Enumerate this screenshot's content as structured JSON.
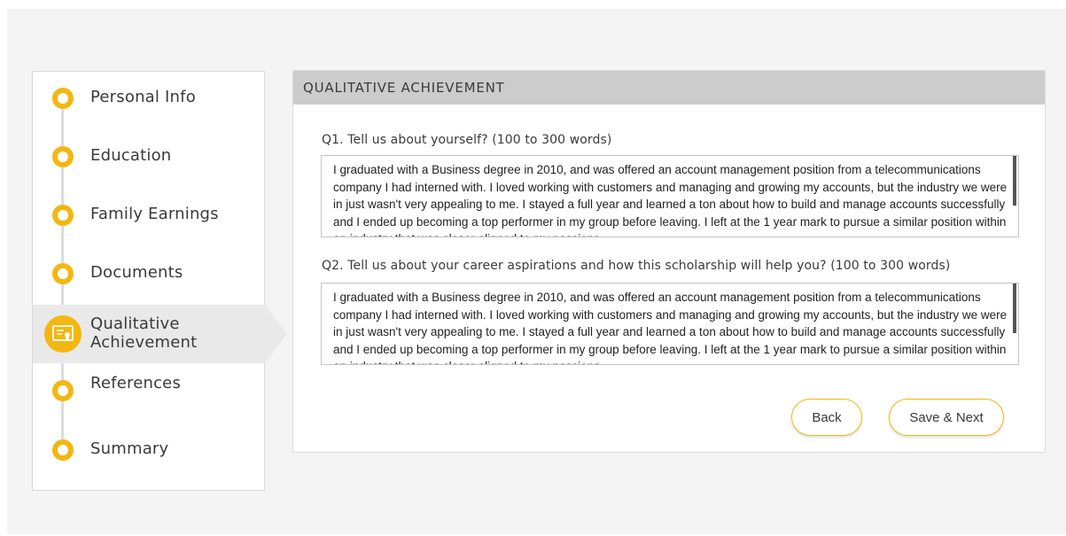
{
  "steps": [
    {
      "label": "Personal Info"
    },
    {
      "label": "Education"
    },
    {
      "label": "Family Earnings"
    },
    {
      "label": "Documents"
    },
    {
      "label": "Qualitative Achievement",
      "line1": "Qualitative",
      "line2": "Achievement",
      "active": true
    },
    {
      "label": "References"
    },
    {
      "label": "Summary"
    }
  ],
  "section": {
    "title": "QUALITATIVE ACHIEVEMENT"
  },
  "questions": [
    {
      "label": "Q1.  Tell us about yourself? (100 to 300 words)",
      "answer": "I graduated with a Business degree in 2010, and was offered an account management position from a telecommunications company I had interned with. I loved working with customers and managing and growing my accounts, but the industry we were in just wasn't very appealing to me. I stayed a full year and learned a ton about how to build and manage accounts successfully and  I ended up becoming a top performer in my group before leaving. I left at the 1 year mark to pursue a similar position within an industry that was closer aligned to my passions."
    },
    {
      "label": "Q2.  Tell us about your career aspirations and how this scholarship will help you? (100 to 300 words)",
      "answer": "I graduated with a Business degree in 2010, and was offered an account management position from a telecommunications company I had interned with. I loved working with customers and managing and growing my accounts, but the industry we were in just wasn't very appealing to me. I stayed a full year and learned a ton about how to build and manage accounts successfully and  I ended up becoming a top performer in my group before leaving. I left at the 1 year mark to pursue a similar position within an industry that was closer aligned to my passions."
    }
  ],
  "buttons": {
    "back": "Back",
    "save_next": "Save & Next"
  },
  "colors": {
    "accent": "#f3b711",
    "header_bg": "#cccccc",
    "active_step_bg": "#e9e9e9"
  }
}
